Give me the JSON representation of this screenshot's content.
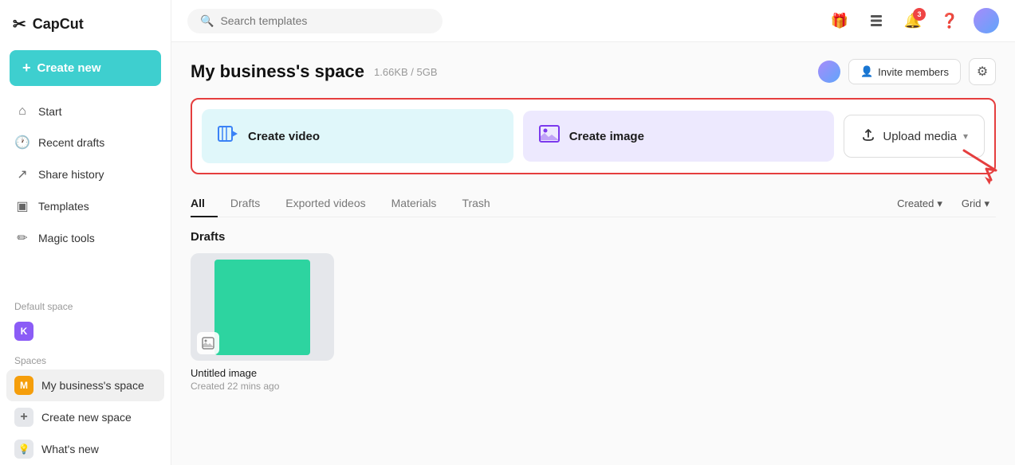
{
  "sidebar": {
    "logo": "CapCut",
    "logo_symbol": "✂",
    "create_new_label": "Create new",
    "nav_items": [
      {
        "id": "start",
        "label": "Start",
        "icon": "⌂"
      },
      {
        "id": "recent_drafts",
        "label": "Recent drafts",
        "icon": "🕐"
      },
      {
        "id": "share_history",
        "label": "Share history",
        "icon": "↗"
      },
      {
        "id": "templates",
        "label": "Templates",
        "icon": "▣"
      },
      {
        "id": "magic_tools",
        "label": "Magic tools",
        "icon": "✏"
      }
    ],
    "default_space_label": "Default space",
    "default_space_avatar": "K",
    "spaces_label": "Spaces",
    "spaces": [
      {
        "id": "my_business",
        "label": "My business's space",
        "avatar": "M",
        "active": true
      },
      {
        "id": "create_new_space",
        "label": "Create new space",
        "avatar": "+"
      },
      {
        "id": "whats_new",
        "label": "What's new",
        "avatar": "💡"
      }
    ]
  },
  "topbar": {
    "search_placeholder": "Search templates",
    "notification_count": "3",
    "icons": [
      "gift",
      "layers",
      "bell",
      "question",
      "avatar"
    ]
  },
  "page": {
    "title": "My business's space",
    "storage": "1.66KB / 5GB",
    "invite_button_label": "Invite members",
    "settings_icon": "⚙"
  },
  "action_cards": {
    "video_label": "Create video",
    "image_label": "Create image",
    "upload_label": "Upload media"
  },
  "tabs": {
    "items": [
      {
        "id": "all",
        "label": "All",
        "active": true
      },
      {
        "id": "drafts",
        "label": "Drafts",
        "active": false
      },
      {
        "id": "exported",
        "label": "Exported videos",
        "active": false
      },
      {
        "id": "materials",
        "label": "Materials",
        "active": false
      },
      {
        "id": "trash",
        "label": "Trash",
        "active": false
      }
    ],
    "sort_label": "Created",
    "view_label": "Grid"
  },
  "drafts_section": {
    "title": "Drafts",
    "items": [
      {
        "id": "untitled_image",
        "name": "Untitled image",
        "meta": "Created 22 mins ago"
      }
    ]
  }
}
